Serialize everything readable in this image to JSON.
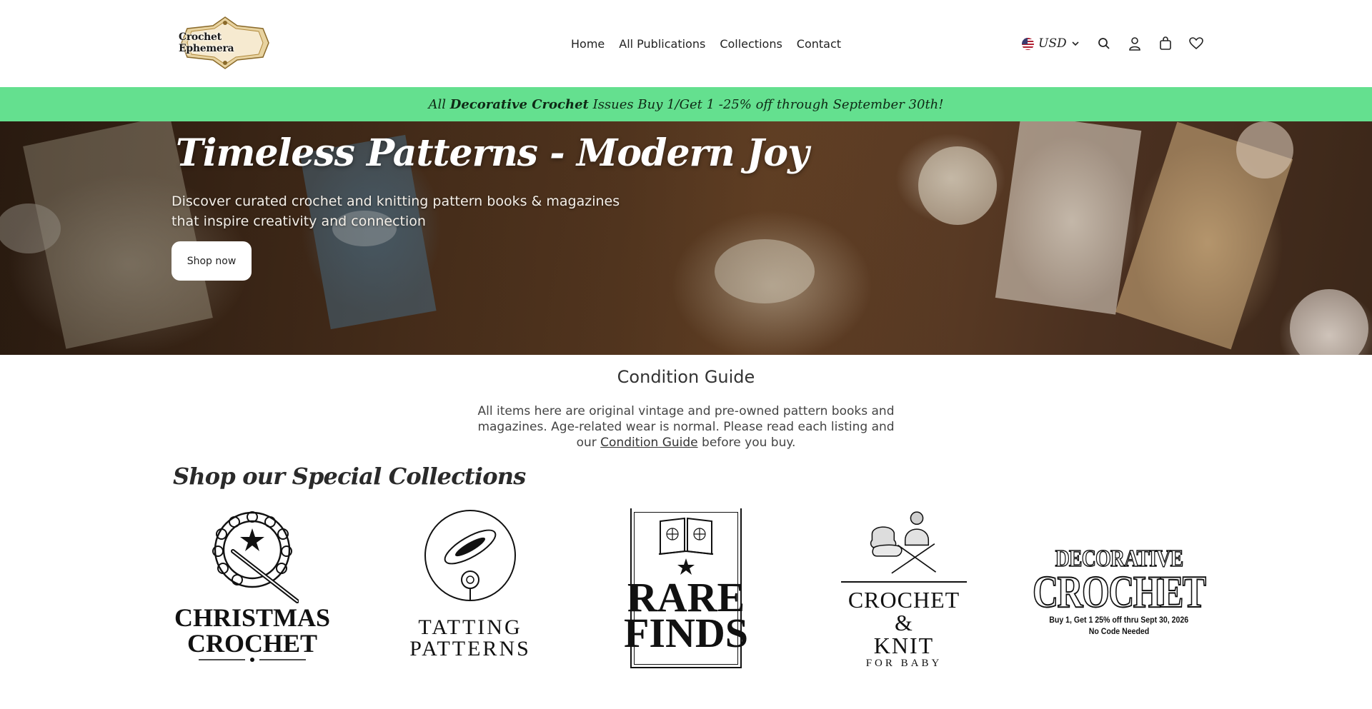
{
  "header": {
    "logo_text": "Crochet Ephemera",
    "nav": [
      {
        "label": "Home"
      },
      {
        "label": "All Publications"
      },
      {
        "label": "Collections"
      },
      {
        "label": "Contact"
      }
    ],
    "currency": "USD",
    "icons": [
      "flag-us-icon",
      "chevron-down-icon",
      "search-icon",
      "account-icon",
      "cart-icon",
      "wishlist-heart-icon"
    ]
  },
  "announcement": {
    "prefix": "All ",
    "bold": "Decorative Crochet",
    "suffix": " Issues Buy 1/Get 1 -25% off through September 30th!"
  },
  "hero": {
    "title": "Timeless Patterns - Modern Joy",
    "subtitle": "Discover curated crochet and knitting pattern books & magazines that inspire creativity and connection",
    "button": "Shop now"
  },
  "condition_guide": {
    "title": "Condition Guide",
    "text_before": "All items here are original vintage and pre-owned pattern books and magazines. Age-related wear is normal. Please read each listing and our ",
    "link": "Condition Guide",
    "text_after": " before you buy."
  },
  "collections": {
    "title": "Shop our Special Collections",
    "items": [
      {
        "line1": "CHRISTMAS",
        "line2": "CROCHET"
      },
      {
        "line1": "TATTING",
        "line2": "PATTERNS"
      },
      {
        "line1": "RARE",
        "line2": "FINDS"
      },
      {
        "line1": "CROCHET &",
        "line2": "KNIT",
        "line3": "FOR BABY"
      },
      {
        "line1": "DECORATIVE",
        "line2": "CROCHET",
        "line3": "Buy 1, Get 1 25% off thru Sept 30, 2026",
        "line4": "No Code Needed"
      }
    ]
  }
}
